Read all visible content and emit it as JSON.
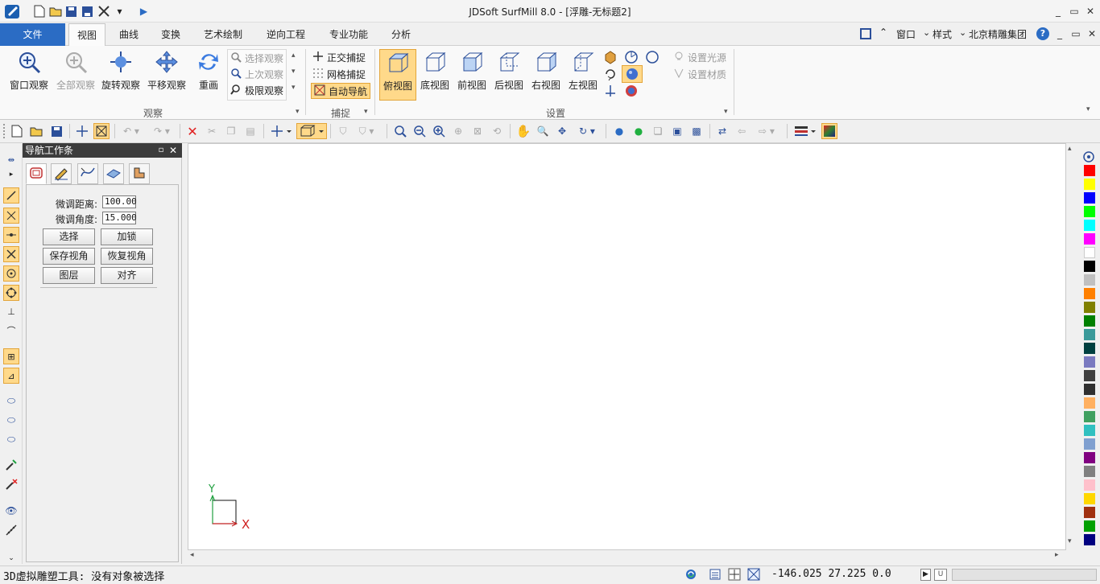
{
  "window": {
    "title": "JDSoft SurfMill 8.0 - [浮雕-无标题2]",
    "minimize": "_",
    "maximize": "▭",
    "close": "✕"
  },
  "menu": {
    "file": "文件",
    "tabs": [
      "视图",
      "曲线",
      "变换",
      "艺术绘制",
      "逆向工程",
      "专业功能",
      "分析"
    ],
    "active_tab": "视图",
    "right": {
      "window": "窗口",
      "style": "样式",
      "company": "北京精雕集团",
      "help": "?"
    }
  },
  "ribbon": {
    "observe": {
      "label": "观察",
      "buttons": [
        "窗口观察",
        "全部观察",
        "旋转观察",
        "平移观察",
        "重画"
      ],
      "small": [
        "选择观察",
        "上次观察",
        "极限观察"
      ]
    },
    "snap": {
      "label": "捕捉",
      "items": [
        "正交捕捉",
        "网格捕捉",
        "自动导航"
      ]
    },
    "settings": {
      "label": "设置",
      "views": [
        "俯视图",
        "底视图",
        "前视图",
        "后视图",
        "右视图",
        "左视图"
      ],
      "light": "设置光源",
      "material": "设置材质"
    }
  },
  "nav_panel": {
    "title": "导航工作条",
    "pin": "▫",
    "close": "✕",
    "fields": [
      {
        "label": "微调距离:",
        "value": "100.00"
      },
      {
        "label": "微调角度:",
        "value": "15.000"
      }
    ],
    "buttons": [
      "选择",
      "加锁",
      "保存视角",
      "恢复视角",
      "图层",
      "对齐"
    ]
  },
  "axes": {
    "x": "X",
    "y": "Y"
  },
  "palette": [
    "#ff0000",
    "#ffff00",
    "#0000ff",
    "#00ff00",
    "#00ffff",
    "#ff00ff",
    "#ffffff",
    "#000000",
    "#c0c0c0",
    "#ff8000",
    "#808000",
    "#008000",
    "#3a9a9a",
    "#004040",
    "#7a7ac0",
    "#404040",
    "#303030",
    "#ffb060",
    "#40a060",
    "#30c0c0",
    "#80a0d0",
    "#800080",
    "#808080",
    "#ffc0cb",
    "#ffd700",
    "#a03010",
    "#00a000",
    "#000080"
  ],
  "colors": {
    "accent": "#2b6cc4",
    "selected": "#ffd98a"
  },
  "status": {
    "message": "3D虚拟雕塑工具: 没有对象被选择",
    "coords": "-146.025 27.225 0.0",
    "u": "U"
  }
}
